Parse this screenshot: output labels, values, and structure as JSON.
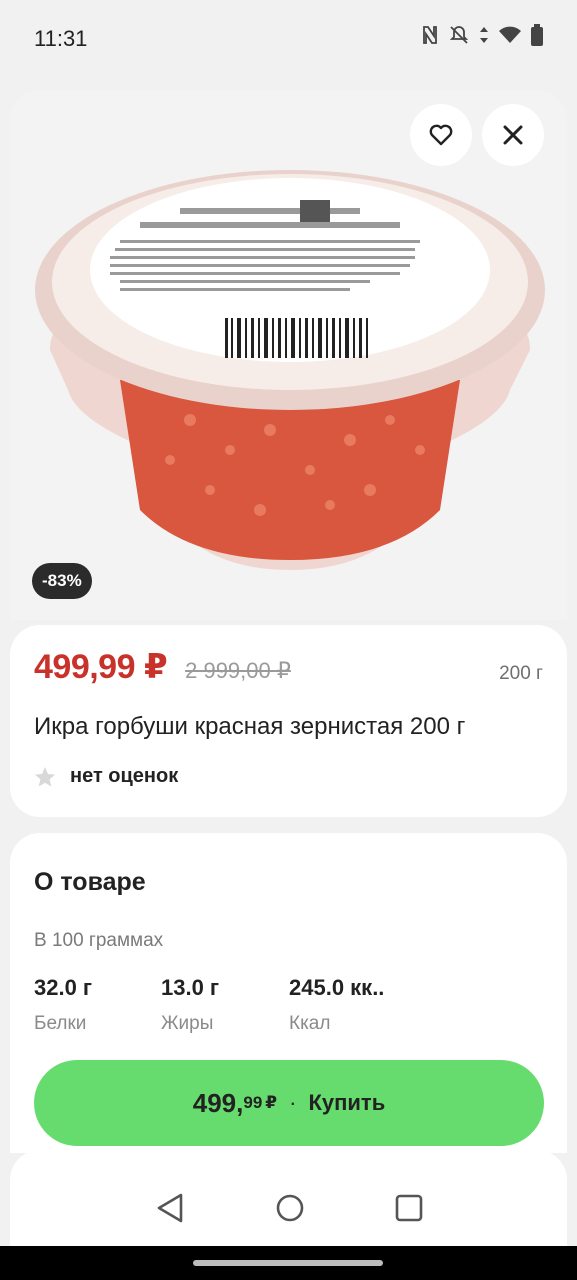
{
  "status_bar": {
    "time": "11:31"
  },
  "image": {
    "discount_badge": "-83%"
  },
  "product": {
    "price_main": "499,99 ₽",
    "price_old": "2 999,00 ₽",
    "weight": "200 г",
    "title": "Икра горбуши красная зернистая 200 г",
    "rating_text": "нет оценок"
  },
  "about": {
    "title": "О товаре",
    "per_100": "В 100 граммах",
    "nutrition": [
      {
        "value": "32.0 г",
        "label": "Белки"
      },
      {
        "value": "13.0 г",
        "label": "Жиры"
      },
      {
        "value": "245.0 кк..",
        "label": "Ккал"
      }
    ]
  },
  "buy_button": {
    "price_int": "499,",
    "price_dec": "99",
    "currency": "₽",
    "separator": "·",
    "label": "Купить",
    "color": "#67dc6e"
  },
  "colors": {
    "price": "#c8322b",
    "badge": "#2b2b2b"
  }
}
